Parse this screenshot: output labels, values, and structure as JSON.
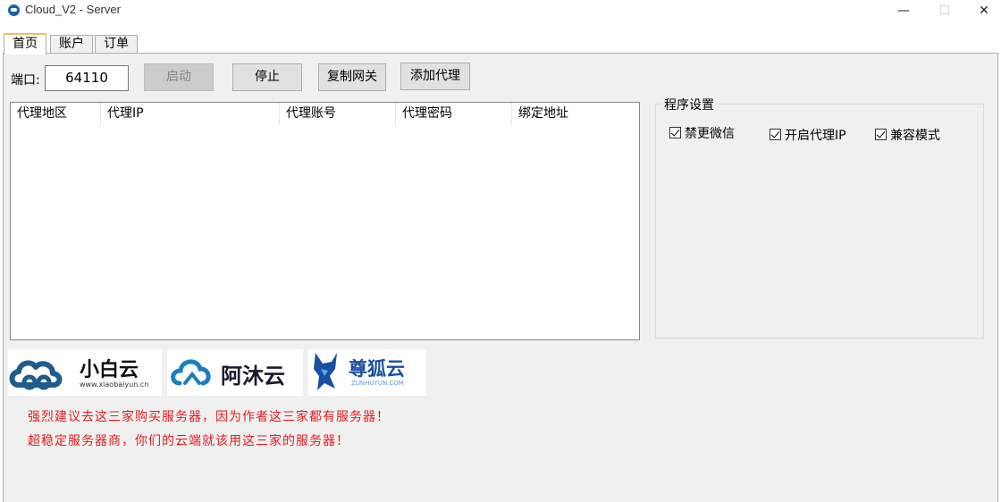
{
  "window": {
    "title": "Cloud_V2 - Server",
    "minimize_glyph": "—",
    "maximize_glyph": "☐",
    "close_glyph": "✕"
  },
  "tabs": [
    {
      "label": "首页",
      "active": true
    },
    {
      "label": "账户",
      "active": false
    },
    {
      "label": "订单",
      "active": false
    }
  ],
  "toolbar": {
    "port_label": "端口:",
    "port_value": "64110",
    "start_label": "启动",
    "stop_label": "停止",
    "copy_gateway_label": "复制网关",
    "add_proxy_label": "添加代理"
  },
  "proxy_table": {
    "columns": [
      "代理地区",
      "代理IP",
      "代理账号",
      "代理密码",
      "绑定地址"
    ],
    "rows": []
  },
  "settings": {
    "title": "程序设置",
    "options": [
      {
        "label": "禁更微信",
        "checked": true
      },
      {
        "label": "开启代理IP",
        "checked": true
      },
      {
        "label": "兼容模式",
        "checked": true
      }
    ]
  },
  "sponsors": [
    {
      "name": "小白云",
      "domain": "www.xiaobaiyun.cn"
    },
    {
      "name": "阿沐云"
    },
    {
      "name": "尊狐云",
      "domain": "ZUNHUYUN.COM"
    }
  ],
  "notices": [
    "强烈建议去这三家购买服务器，因为作者这三家都有服务器！",
    "超稳定服务器商，你们的云端就该用这三家的服务器！"
  ],
  "colors": {
    "notice": "#e01e1e",
    "xiaobaiyun_brand": "#1f5d8f",
    "amuyun_brand": "#1a7fc1",
    "zunhuyun_brand": "#1b4fa0"
  }
}
